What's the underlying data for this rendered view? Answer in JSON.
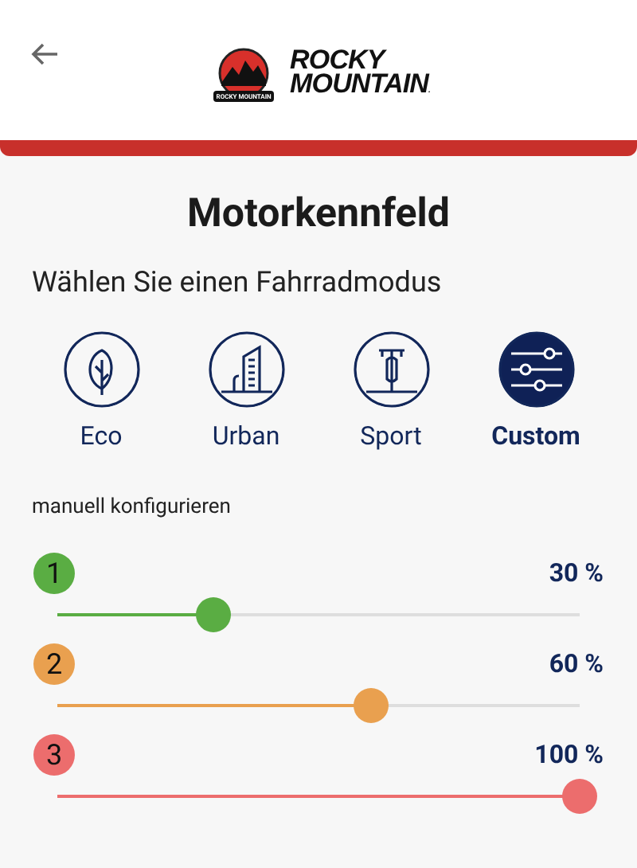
{
  "header": {
    "logo": {
      "badge_text": "ROCKY MOUNTAIN",
      "line_1": "ROCKY",
      "line_2": "MOUNTAIN",
      "mark": "."
    }
  },
  "title": "Motorkennfeld",
  "subtitle": "Wählen Sie einen Fahrradmodus",
  "modes": [
    {
      "kind": "eco",
      "label": "Eco",
      "selected": false
    },
    {
      "kind": "urban",
      "label": "Urban",
      "selected": false
    },
    {
      "kind": "sport",
      "label": "Sport",
      "selected": false
    },
    {
      "kind": "custom",
      "label": "Custom",
      "selected": true
    }
  ],
  "section_label": "manuell konfigurieren",
  "levels": [
    {
      "number": "1",
      "color": "#5aad43",
      "level": 0.3,
      "reading": "30 %"
    },
    {
      "number": "2",
      "color": "#e9a04f",
      "level": 0.6,
      "reading": "60 %"
    },
    {
      "number": "3",
      "color": "#ec6d6d",
      "level": 1,
      "reading": "100 %"
    }
  ]
}
